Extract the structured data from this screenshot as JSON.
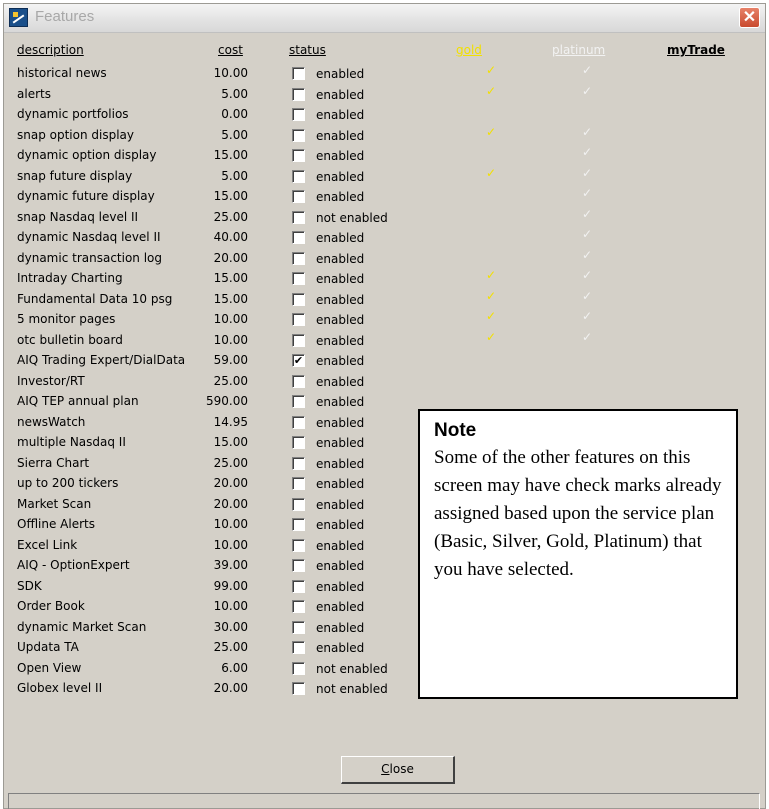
{
  "window": {
    "title": "Features",
    "close_glyph": "✕"
  },
  "columns": {
    "description": "description",
    "cost": "cost",
    "status": "status",
    "gold": "gold",
    "platinum": "platinum",
    "mytrade": "myTrade"
  },
  "colors": {
    "gold": "#f2e000",
    "platinum": "#f2f2f2",
    "background": "#d4d0c8"
  },
  "features": [
    {
      "description": "historical news",
      "cost": "10.00",
      "checked": false,
      "status": "enabled",
      "gold": true,
      "platinum": true
    },
    {
      "description": "alerts",
      "cost": "5.00",
      "checked": false,
      "status": "enabled",
      "gold": true,
      "platinum": true
    },
    {
      "description": "dynamic portfolios",
      "cost": "0.00",
      "checked": false,
      "status": "enabled",
      "gold": false,
      "platinum": false
    },
    {
      "description": "snap option display",
      "cost": "5.00",
      "checked": false,
      "status": "enabled",
      "gold": true,
      "platinum": true
    },
    {
      "description": "dynamic option display",
      "cost": "15.00",
      "checked": false,
      "status": "enabled",
      "gold": false,
      "platinum": true
    },
    {
      "description": "snap future display",
      "cost": "5.00",
      "checked": false,
      "status": "enabled",
      "gold": true,
      "platinum": true
    },
    {
      "description": "dynamic future display",
      "cost": "15.00",
      "checked": false,
      "status": "enabled",
      "gold": false,
      "platinum": true
    },
    {
      "description": "snap Nasdaq level II",
      "cost": "25.00",
      "checked": false,
      "status": "not enabled",
      "gold": false,
      "platinum": true
    },
    {
      "description": "dynamic Nasdaq level II",
      "cost": "40.00",
      "checked": false,
      "status": "enabled",
      "gold": false,
      "platinum": true
    },
    {
      "description": "dynamic transaction log",
      "cost": "20.00",
      "checked": false,
      "status": "enabled",
      "gold": false,
      "platinum": true
    },
    {
      "description": "Intraday Charting",
      "cost": "15.00",
      "checked": false,
      "status": "enabled",
      "gold": true,
      "platinum": true
    },
    {
      "description": "Fundamental Data 10 psg",
      "cost": "15.00",
      "checked": false,
      "status": "enabled",
      "gold": true,
      "platinum": true
    },
    {
      "description": "5 monitor pages",
      "cost": "10.00",
      "checked": false,
      "status": "enabled",
      "gold": true,
      "platinum": true
    },
    {
      "description": "otc bulletin board",
      "cost": "10.00",
      "checked": false,
      "status": "enabled",
      "gold": true,
      "platinum": true
    },
    {
      "description": "AIQ Trading Expert/DialData",
      "cost": "59.00",
      "checked": true,
      "status": "enabled",
      "gold": false,
      "platinum": false
    },
    {
      "description": "Investor/RT",
      "cost": "25.00",
      "checked": false,
      "status": "enabled",
      "gold": false,
      "platinum": false
    },
    {
      "description": "AIQ TEP annual plan",
      "cost": "590.00",
      "checked": false,
      "status": "enabled",
      "gold": false,
      "platinum": false
    },
    {
      "description": "newsWatch",
      "cost": "14.95",
      "checked": false,
      "status": "enabled",
      "gold": false,
      "platinum": false
    },
    {
      "description": "multiple Nasdaq II",
      "cost": "15.00",
      "checked": false,
      "status": "enabled",
      "gold": false,
      "platinum": false
    },
    {
      "description": "Sierra Chart",
      "cost": "25.00",
      "checked": false,
      "status": "enabled",
      "gold": false,
      "platinum": false
    },
    {
      "description": "up to 200 tickers",
      "cost": "20.00",
      "checked": false,
      "status": "enabled",
      "gold": false,
      "platinum": false
    },
    {
      "description": "Market Scan",
      "cost": "20.00",
      "checked": false,
      "status": "enabled",
      "gold": false,
      "platinum": false
    },
    {
      "description": "Offline Alerts",
      "cost": "10.00",
      "checked": false,
      "status": "enabled",
      "gold": false,
      "platinum": false
    },
    {
      "description": "Excel Link",
      "cost": "10.00",
      "checked": false,
      "status": "enabled",
      "gold": false,
      "platinum": false
    },
    {
      "description": "AIQ - OptionExpert",
      "cost": "39.00",
      "checked": false,
      "status": "enabled",
      "gold": false,
      "platinum": false
    },
    {
      "description": "SDK",
      "cost": "99.00",
      "checked": false,
      "status": "enabled",
      "gold": false,
      "platinum": false
    },
    {
      "description": "Order Book",
      "cost": "10.00",
      "checked": false,
      "status": "enabled",
      "gold": false,
      "platinum": false
    },
    {
      "description": "dynamic Market Scan",
      "cost": "30.00",
      "checked": false,
      "status": "enabled",
      "gold": false,
      "platinum": false
    },
    {
      "description": "Updata TA",
      "cost": "25.00",
      "checked": false,
      "status": "enabled",
      "gold": false,
      "platinum": false
    },
    {
      "description": "Open View",
      "cost": "6.00",
      "checked": false,
      "status": "not enabled",
      "gold": false,
      "platinum": false
    },
    {
      "description": "Globex level II",
      "cost": "20.00",
      "checked": false,
      "status": "not enabled",
      "gold": false,
      "platinum": false
    }
  ],
  "note": {
    "title": "Note",
    "body": "Some of the other features on this screen may have check marks already assigned based upon the service plan (Basic, Silver, Gold, Platinum) that you have selected."
  },
  "buttons": {
    "close_mnemonic": "C",
    "close_rest": "lose"
  }
}
